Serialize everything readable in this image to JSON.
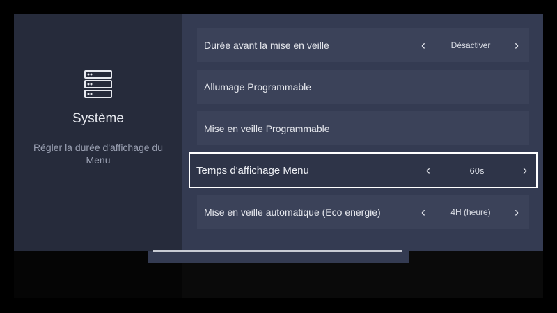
{
  "system": {
    "title": "Système",
    "description": "Régler la durée d'affichage du Menu",
    "icon": "server-icon"
  },
  "settings": [
    {
      "label": "Durée avant la mise en veille",
      "value": "Désactiver",
      "has_selector": true
    },
    {
      "label": "Allumage Programmable",
      "value": "",
      "has_selector": false
    },
    {
      "label": "Mise en veille Programmable",
      "value": "",
      "has_selector": false
    },
    {
      "label": "Temps d'affichage Menu",
      "value": "60s",
      "has_selector": true,
      "selected": true
    },
    {
      "label": "Mise en veille automatique (Eco energie)",
      "value": "4H (heure)",
      "has_selector": true
    }
  ],
  "colors": {
    "left_panel": "#262b3b",
    "right_panel": "#343b52",
    "row": "#3b4259",
    "focus_border": "#ffffff"
  }
}
